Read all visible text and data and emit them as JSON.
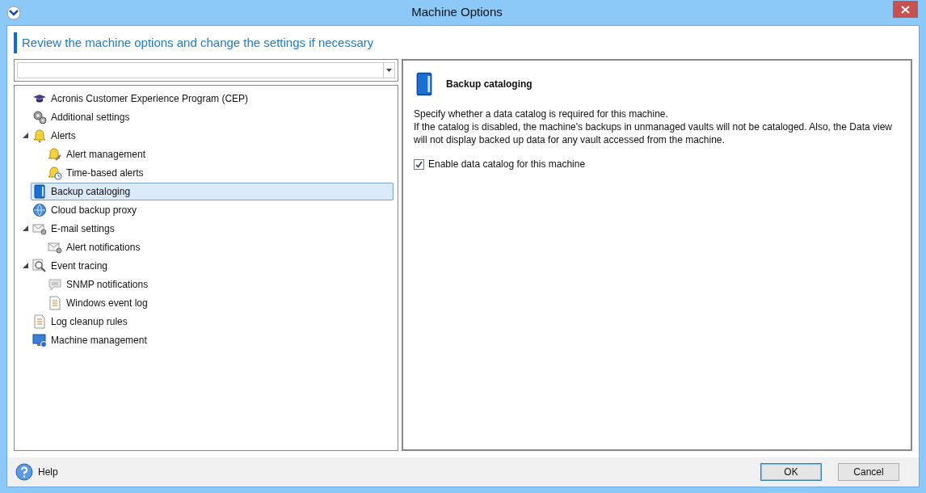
{
  "window": {
    "title": "Machine Options"
  },
  "header": "Review the machine options and change the settings if necessary",
  "tree": [
    {
      "label": "Acronis Customer Experience Program (CEP)",
      "kind": "cap",
      "selected": false
    },
    {
      "label": "Additional settings",
      "kind": "gears",
      "selected": false
    },
    {
      "label": "Alerts",
      "kind": "bell",
      "selected": false,
      "expanded": true,
      "children": [
        {
          "label": "Alert management",
          "kind": "bell-tool",
          "selected": false
        },
        {
          "label": "Time-based alerts",
          "kind": "bell-clock",
          "selected": false
        }
      ]
    },
    {
      "label": "Backup cataloging",
      "kind": "book",
      "selected": true
    },
    {
      "label": "Cloud backup proxy",
      "kind": "globe",
      "selected": false
    },
    {
      "label": "E-mail settings",
      "kind": "mail",
      "selected": false,
      "expanded": true,
      "children": [
        {
          "label": "Alert notifications",
          "kind": "mail",
          "selected": false
        }
      ]
    },
    {
      "label": "Event tracing",
      "kind": "magnifier",
      "selected": false,
      "expanded": true,
      "children": [
        {
          "label": "SNMP notifications",
          "kind": "speech",
          "selected": false
        },
        {
          "label": "Windows event log",
          "kind": "log",
          "selected": false
        }
      ]
    },
    {
      "label": "Log cleanup rules",
      "kind": "log",
      "selected": false
    },
    {
      "label": "Machine management",
      "kind": "monitor",
      "selected": false
    }
  ],
  "detail": {
    "title": "Backup cataloging",
    "kind": "book",
    "description": [
      "Specify whether a data catalog is required for this machine.",
      "If the catalog is disabled, the machine's backups in unmanaged vaults will not be cataloged. Also, the Data view will not display backed up data for any vault accessed from the machine."
    ],
    "option": {
      "label": "Enable data catalog for this machine",
      "checked": true
    }
  },
  "footer": {
    "help": "Help",
    "buttons": [
      {
        "label": "OK",
        "default": true
      },
      {
        "label": "Cancel",
        "default": false
      }
    ]
  }
}
